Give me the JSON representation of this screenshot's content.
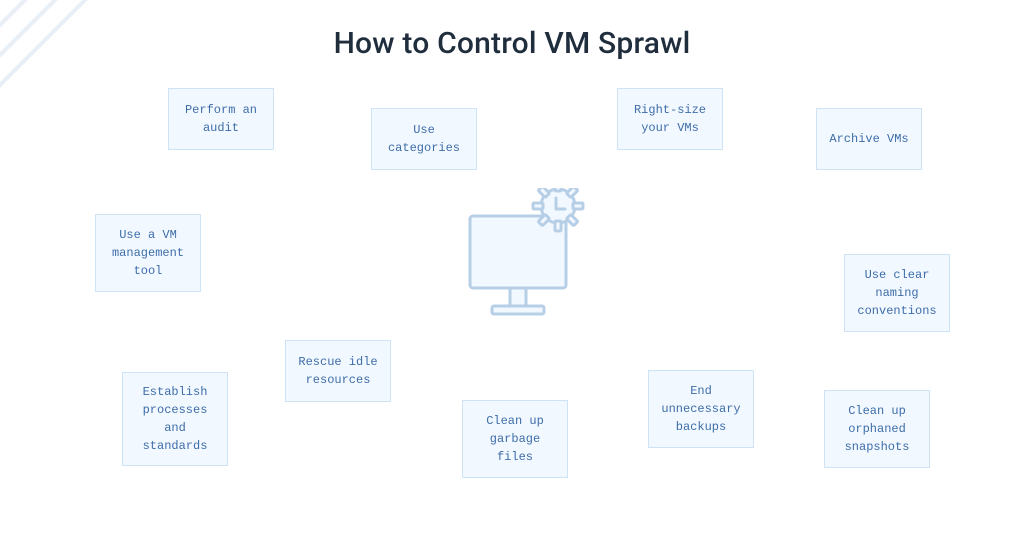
{
  "title": "How to Control VM Sprawl",
  "cards": {
    "perform_audit": "Perform an\naudit",
    "use_categories": "Use\ncategories",
    "right_size": "Right-size\nyour VMs",
    "archive_vms": "Archive VMs",
    "use_vm_tool": "Use a VM\nmanagement\ntool",
    "use_naming": "Use clear\nnaming\nconventions",
    "establish_processes": "Establish\nprocesses\nand\nstandards",
    "rescue_idle": "Rescue idle\nresources",
    "cleanup_garbage": "Clean up\ngarbage\nfiles",
    "end_backups": "End\nunnecessary\nbackups",
    "cleanup_snapshots": "Clean up\norphaned\nsnapshots"
  },
  "colors": {
    "card_bg": "#f1f8ff",
    "card_border": "#cfe3f7",
    "card_text": "#3e6da8",
    "title_text": "#1f2d3d",
    "illustration_stroke": "#b7cfe6",
    "stripe": "#e8eff6"
  }
}
